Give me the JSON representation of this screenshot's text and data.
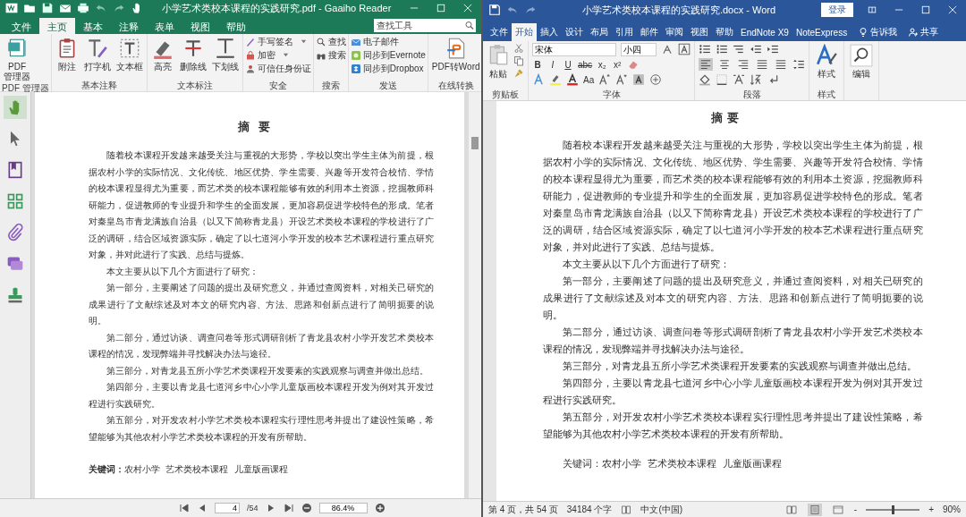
{
  "left_window": {
    "title": "小学艺术类校本课程的实践研究.pdf - Gaaiho Reader",
    "tabs": [
      {
        "label": "文件",
        "selected": false
      },
      {
        "label": "主页",
        "selected": true
      },
      {
        "label": "基本",
        "selected": false
      },
      {
        "label": "注释",
        "selected": false
      },
      {
        "label": "表单",
        "selected": false
      },
      {
        "label": "视图",
        "selected": false
      },
      {
        "label": "帮助",
        "selected": false
      }
    ],
    "search": {
      "placeholder": "查找工具"
    },
    "ribbon_groups": [
      {
        "label": "PDF 管理器",
        "buttons": [
          {
            "kind": "pdf-manager",
            "label": "PDF\n管理器"
          }
        ]
      },
      {
        "label": "基本注释",
        "buttons": [
          {
            "kind": "note",
            "label": "附注"
          },
          {
            "kind": "typewriter",
            "label": "打字机"
          },
          {
            "kind": "textbox",
            "label": "文本框"
          }
        ]
      },
      {
        "label": "文本标注",
        "buttons": [
          {
            "kind": "highlight",
            "label": "高亮"
          },
          {
            "kind": "strikethrough",
            "label": "删除线"
          },
          {
            "kind": "underline",
            "label": "下划线"
          }
        ]
      },
      {
        "label": "安全",
        "items": [
          {
            "kind": "signature",
            "label": "手写签名",
            "dropdown": true
          },
          {
            "kind": "lock",
            "label": "加密",
            "dropdown": true
          },
          {
            "kind": "id",
            "label": "可信任身份证",
            "dropdown": false
          }
        ]
      },
      {
        "label": "搜索",
        "items": [
          {
            "kind": "search",
            "label": "查找",
            "dropdown": false
          },
          {
            "kind": "binoculars",
            "label": "搜索",
            "dropdown": false
          }
        ]
      },
      {
        "label": "发送",
        "items": [
          {
            "kind": "email",
            "label": "电子邮件",
            "dropdown": false
          },
          {
            "kind": "evernote",
            "label": "同步到Evernote",
            "dropdown": false
          },
          {
            "kind": "dropbox",
            "label": "同步到Dropbox",
            "dropdown": false
          }
        ]
      },
      {
        "label": "在线转换",
        "buttons": [
          {
            "kind": "pdf-word",
            "label": "PDF转Word"
          }
        ]
      }
    ],
    "side_tools": [
      {
        "kind": "hand",
        "selected": true
      },
      {
        "kind": "pointer",
        "selected": false
      },
      {
        "kind": "bookmark",
        "selected": false
      },
      {
        "kind": "thumbnails",
        "selected": false
      },
      {
        "kind": "attachment",
        "selected": false
      },
      {
        "kind": "comments",
        "selected": false
      },
      {
        "kind": "stamp",
        "selected": false
      }
    ],
    "page": {
      "title": "摘  要",
      "paragraphs": [
        "随着校本课程开发越来越受关注与重视的大形势，学校以突出学生主体为前提，根据农村小学的实际情况、文化传统、地区优势、学生需要、兴趣等开发符合校情、学情的校本课程显得尤为重要，而艺术类的校本课程能够有效的利用本土资源，挖掘教师科研能力，促进教师的专业提升和学生的全面发展，更加容易促进学校特色的形成。笔者对秦皇岛市青龙满族自治县（以又下简称青龙县）开设艺术类校本课程的学校进行了广泛的调研，结合区域资源实际，确定了以七道河小学开发的校本艺术课程进行重点研究对象，并对此进行了实践、总结与提炼。",
        "本文主要从以下几个方面进行了研究：",
        "第一部分，主要阐述了问题的提出及研究意义，并通过查阅资料，对相关已研究的成果进行了文献综述及对本文的研究内容、方法、思路和创新点进行了简明扼要的说明。",
        "第二部分，通过访谈、调查问卷等形式调研剖析了青龙县农村小学开发艺术类校本课程的情况，发现弊端并寻找解决办法与途径。",
        "第三部分，对青龙县五所小学艺术类课程开发要素的实践观察与调查并做出总结。",
        "第四部分，主要以青龙县七道河乡中心小学儿童版画校本课程开发为例对其开发过程进行实践研究。",
        "第五部分，对开发农村小学艺术类校本课程实行理性思考并提出了建设性策略，希望能够为其他农村小学艺术类校本课程的开发有所帮助。"
      ],
      "keywords": "**关键词：**农村小学  艺术类校本课程  儿童版画课程"
    },
    "status_bar": {
      "page_field": "4",
      "page_total": "/54",
      "zoom": "86.4%"
    }
  },
  "right_window": {
    "title": "小学艺术类校本课程的实践研究.docx - Word",
    "login_button": "登录",
    "tabs": [
      {
        "label": "文件",
        "selected": false
      },
      {
        "label": "开始",
        "selected": true
      },
      {
        "label": "插入",
        "selected": false
      },
      {
        "label": "设计",
        "selected": false
      },
      {
        "label": "布局",
        "selected": false
      },
      {
        "label": "引用",
        "selected": false
      },
      {
        "label": "邮件",
        "selected": false
      },
      {
        "label": "审阅",
        "selected": false
      },
      {
        "label": "视图",
        "selected": false
      },
      {
        "label": "帮助",
        "selected": false
      },
      {
        "label": "EndNote X9",
        "selected": false
      },
      {
        "label": "NoteExpress",
        "selected": false
      }
    ],
    "tell_me": "告诉我",
    "share": "共享",
    "clipboard": {
      "paste_label": "粘贴",
      "group_label": "剪贴板"
    },
    "font": {
      "name": "宋体",
      "size": "小四",
      "format_buttons": [
        "B",
        "I",
        "U",
        "abc",
        "x₂",
        "x²"
      ],
      "case_button": "Aa",
      "group_label": "字体"
    },
    "paragraph": {
      "align": [
        {
          "kind": "left",
          "selected": true
        },
        {
          "kind": "center",
          "selected": false
        },
        {
          "kind": "right",
          "selected": false
        },
        {
          "kind": "justify",
          "selected": false
        },
        {
          "kind": "distributed",
          "selected": false
        }
      ],
      "group_label": "段落"
    },
    "styles": {
      "button_label": "样式",
      "group_label": "样式"
    },
    "editing": {
      "button_label": "编辑"
    },
    "page": {
      "title": "摘 要",
      "paragraphs": [
        "随着校本课程开发越来越受关注与重视的大形势，学校以突出学生主体为前提，根据农村小学的实际情况、文化传统、地区优势、学生需要、兴趣等开发符合校情、学情的校本课程显得尤为重要，而艺术类的校本课程能够有效的利用本土资源，挖掘教师科研能力，促进教师的专业提升和学生的全面发展，更加容易促进学校特色的形成。笔者对秦皇岛市青龙满族自治县（以又下简称青龙县）开设艺术类校本课程的学校进行了广泛的调研，结合区域资源实际，确定了以七道河小学开发的校本艺术课程进行重点研究对象，并对此进行了实践、总结与提炼。",
        "本文主要从以下几个方面进行了研究：",
        "第一部分，主要阐述了问题的提出及研究意义，并通过查阅资料，对相关已研究的成果进行了文献综述及对本文的研究内容、方法、思路和创新点进行了简明扼要的说明。",
        "第二部分，通过访谈、调查问卷等形式调研剖析了青龙县农村小学开发艺术类校本课程的情况，发现弊端并寻找解决办法与途径。",
        "第三部分，对青龙县五所小学艺术类课程开发要素的实践观察与调查并做出总结。",
        "第四部分，主要以青龙县七道河乡中心小学儿童版画校本课程开发为例对其开发过程进行实践研究。",
        "第五部分，对开发农村小学艺术类校本课程实行理性思考并提出了建设性策略，希望能够为其他农村小学艺术类校本课程的开发有所帮助。"
      ],
      "keywords": "关键词：农村小学  艺术类校本课程  儿童版画课程"
    },
    "status_bar": {
      "page_info": "第 4 页，共 54 页",
      "word_count": "34184 个字",
      "language": "中文(中国)",
      "views": [
        {
          "kind": "read",
          "selected": false
        },
        {
          "kind": "print",
          "selected": true
        },
        {
          "kind": "web",
          "selected": false
        }
      ],
      "zoom_out": "-",
      "zoom_in": "+",
      "zoom_slider": {
        "level": 0.5
      },
      "zoom": "90%"
    }
  }
}
